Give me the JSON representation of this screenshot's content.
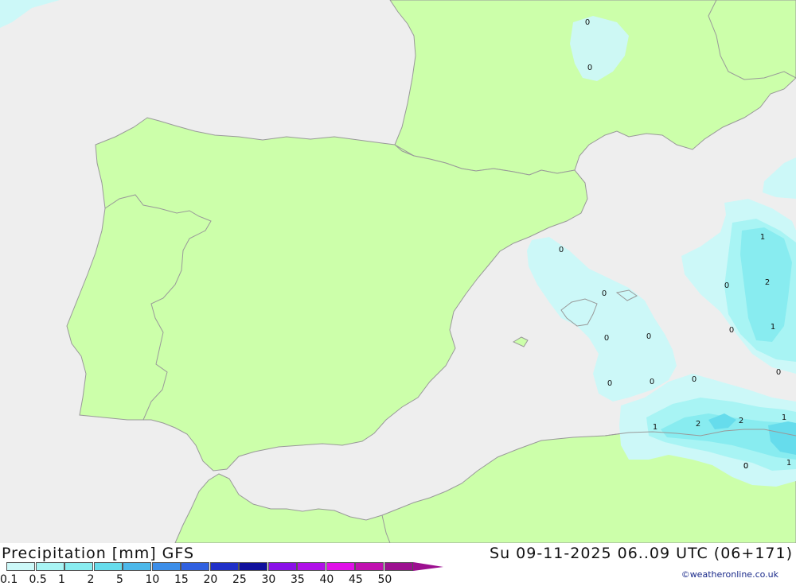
{
  "map": {
    "colors": {
      "sea": "#eeeeee",
      "land": "#ccffaa",
      "coast": "#999999",
      "precip_0_1": "#ccf8f8",
      "precip_0_5": "#a8f4f4",
      "precip_1": "#88ecf0",
      "precip_2": "#66dcec"
    },
    "contour_labels": [
      {
        "id": "fr-1",
        "text": "0"
      },
      {
        "id": "fr-2",
        "text": "0"
      },
      {
        "id": "bal-1",
        "text": "0"
      },
      {
        "id": "bal-2",
        "text": "0"
      },
      {
        "id": "bal-3",
        "text": "0"
      },
      {
        "id": "bal-4",
        "text": "0"
      },
      {
        "id": "bal-5",
        "text": "0"
      },
      {
        "id": "bal-6",
        "text": "0"
      },
      {
        "id": "bal-7",
        "text": "0"
      },
      {
        "id": "sar-1",
        "text": "1"
      },
      {
        "id": "sar-2",
        "text": "0"
      },
      {
        "id": "sar-3",
        "text": "2"
      },
      {
        "id": "sar-4",
        "text": "0"
      },
      {
        "id": "sar-5",
        "text": "1"
      },
      {
        "id": "sar-6",
        "text": "0"
      },
      {
        "id": "alg-1",
        "text": "0"
      },
      {
        "id": "alg-2",
        "text": "1"
      },
      {
        "id": "alg-3",
        "text": "2"
      },
      {
        "id": "alg-4",
        "text": "2"
      },
      {
        "id": "alg-5",
        "text": "1"
      },
      {
        "id": "alg-6",
        "text": "0"
      },
      {
        "id": "alg-7",
        "text": "1"
      }
    ]
  },
  "footer": {
    "title": "Precipitation [mm] GFS",
    "timestamp": "Su 09-11-2025 06..09 UTC (06+171)",
    "credit": "©weatheronline.co.uk",
    "legend": [
      {
        "label": "0.1",
        "color": "#ccf8f8"
      },
      {
        "label": "0.5",
        "color": "#a8f4f4"
      },
      {
        "label": "1",
        "color": "#88ecf0"
      },
      {
        "label": "2",
        "color": "#66dcec"
      },
      {
        "label": "5",
        "color": "#4cb8ea"
      },
      {
        "label": "10",
        "color": "#3c8ee8"
      },
      {
        "label": "15",
        "color": "#3060e0"
      },
      {
        "label": "20",
        "color": "#2030c8"
      },
      {
        "label": "25",
        "color": "#10109c"
      },
      {
        "label": "30",
        "color": "#8a10e8"
      },
      {
        "label": "35",
        "color": "#b010e8"
      },
      {
        "label": "40",
        "color": "#e010e8"
      },
      {
        "label": "45",
        "color": "#c010b0"
      },
      {
        "label": "50",
        "color": "#9c1090"
      }
    ]
  }
}
